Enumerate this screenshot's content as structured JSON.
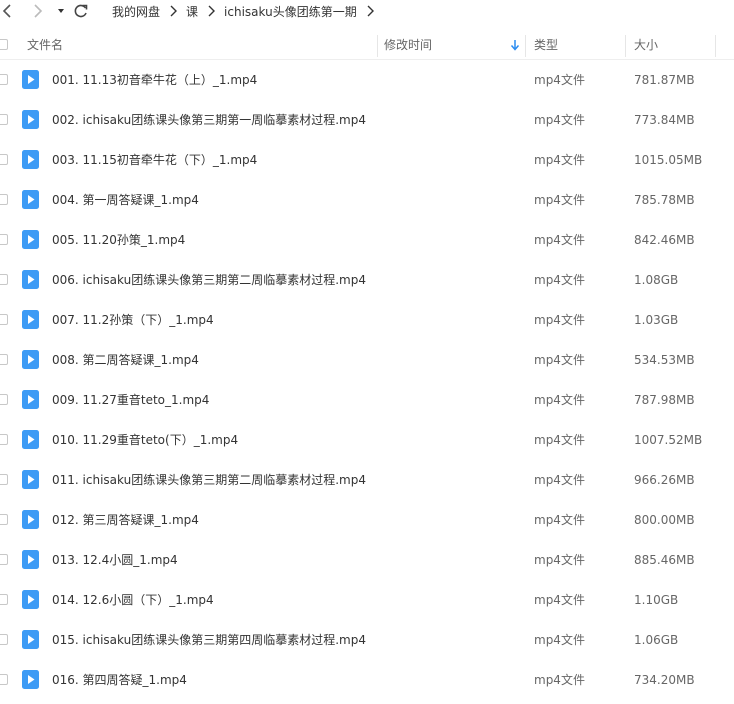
{
  "breadcrumb": [
    "我的网盘",
    "课",
    "ichisaku头像团练第一期"
  ],
  "columns": {
    "name": "文件名",
    "modified": "修改时间",
    "type": "类型",
    "size": "大小"
  },
  "colors": {
    "accent": "#2b8cf0",
    "text": "#333333",
    "muted": "#666666"
  },
  "files": [
    {
      "name": "001.  11.13初音牵牛花（上）_1.mp4",
      "type": "mp4文件",
      "size": "781.87MB"
    },
    {
      "name": "002.  ichisaku团练课头像第三期第一周临摹素材过程.mp4",
      "type": "mp4文件",
      "size": "773.84MB"
    },
    {
      "name": "003.  11.15初音牵牛花（下）_1.mp4",
      "type": "mp4文件",
      "size": "1015.05MB"
    },
    {
      "name": "004.  第一周答疑课_1.mp4",
      "type": "mp4文件",
      "size": "785.78MB"
    },
    {
      "name": "005.  11.20孙策_1.mp4",
      "type": "mp4文件",
      "size": "842.46MB"
    },
    {
      "name": "006.  ichisaku团练课头像第三期第二周临摹素材过程.mp4",
      "type": "mp4文件",
      "size": "1.08GB"
    },
    {
      "name": "007.  11.2孙策（下）_1.mp4",
      "type": "mp4文件",
      "size": "1.03GB"
    },
    {
      "name": "008.  第二周答疑课_1.mp4",
      "type": "mp4文件",
      "size": "534.53MB"
    },
    {
      "name": "009.  11.27重音teto_1.mp4",
      "type": "mp4文件",
      "size": "787.98MB"
    },
    {
      "name": "010.  11.29重音teto(下）_1.mp4",
      "type": "mp4文件",
      "size": "1007.52MB"
    },
    {
      "name": "011.  ichisaku团练课头像第三期第二周临摹素材过程.mp4",
      "type": "mp4文件",
      "size": "966.26MB"
    },
    {
      "name": "012.  第三周答疑课_1.mp4",
      "type": "mp4文件",
      "size": "800.00MB"
    },
    {
      "name": "013.  12.4小圆_1.mp4",
      "type": "mp4文件",
      "size": "885.46MB"
    },
    {
      "name": "014.  12.6小圆（下）_1.mp4",
      "type": "mp4文件",
      "size": "1.10GB"
    },
    {
      "name": "015.  ichisaku团练课头像第三期第四周临摹素材过程.mp4",
      "type": "mp4文件",
      "size": "1.06GB"
    },
    {
      "name": "016.  第四周答疑_1.mp4",
      "type": "mp4文件",
      "size": "734.20MB"
    }
  ]
}
